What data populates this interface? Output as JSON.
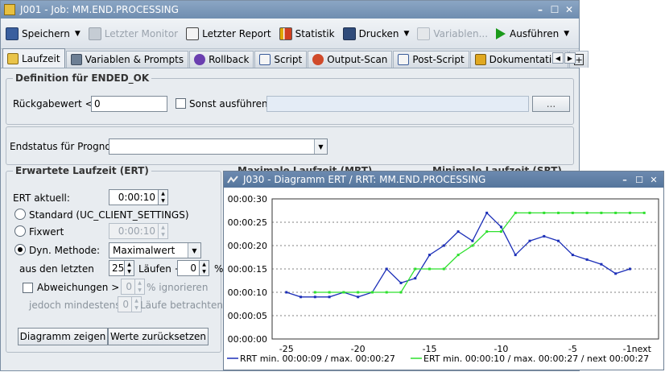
{
  "window": {
    "title": "J001 - Job: MM.END.PROCESSING",
    "controls": {
      "minimize": "–",
      "maximize": "☐",
      "close": "✕"
    }
  },
  "toolbar": {
    "save": "Speichern",
    "last_monitor": "Letzter Monitor",
    "last_report": "Letzter Report",
    "statistics": "Statistik",
    "print": "Drucken",
    "variables": "Variablen...",
    "execute": "Ausführen"
  },
  "tabs": [
    {
      "label": "Laufzeit",
      "active": true
    },
    {
      "label": "Variablen & Prompts"
    },
    {
      "label": "Rollback"
    },
    {
      "label": "Script"
    },
    {
      "label": "Output-Scan"
    },
    {
      "label": "Post-Script"
    },
    {
      "label": "Dokumentation"
    }
  ],
  "definition": {
    "legend": "Definition für ENDED_OK",
    "return_label": "Rückgabewert <=:",
    "return_value": "0",
    "else_label": "Sonst ausführen:",
    "browse_label": "..."
  },
  "endstatus": {
    "label": "Endstatus für Prognose:",
    "value": ""
  },
  "ert": {
    "legend": "Erwartete Laufzeit (ERT)",
    "current_label": "ERT aktuell:",
    "current_value": "0:00:10",
    "standard_label": "Standard (UC_CLIENT_SETTINGS)",
    "fixed_label": "Fixwert",
    "fixed_value": "0:00:10",
    "dyn_label": "Dyn. Methode:",
    "dyn_value": "Maximalwert",
    "last_label": "aus den letzten",
    "last_value": "25",
    "runs_plus": "Läufen +",
    "plus_value": "0",
    "percent": "%",
    "deviation_label": "Abweichungen >",
    "deviation_value": "0",
    "ignore_label": "% ignorieren",
    "min_label": "jedoch mindestens:",
    "min_value": "0",
    "runs_consider": "Läufe betrachten",
    "show_chart": "Diagramm zeigen",
    "reset_values": "Werte zurücksetzen",
    "behind_mrt": "Maximale Laufzeit (MRT)",
    "behind_srt": "Minimale Laufzeit (SRT)"
  },
  "diagram": {
    "title": "J030 - Diagramm ERT / RRT: MM.END.PROCESSING",
    "legend_rrt": "RRT min. 00:00:09 / max. 00:00:27",
    "legend_ert": "ERT min. 00:00:10 / max. 00:00:27 / next 00:00:27"
  },
  "chart_data": {
    "type": "line",
    "x": [
      -25,
      -24,
      -23,
      -22,
      -21,
      -20,
      -19,
      -18,
      -17,
      -16,
      -15,
      -14,
      -13,
      -12,
      -11,
      -10,
      -9,
      -8,
      -7,
      -6,
      -5,
      -4,
      -3,
      -2,
      -1,
      0
    ],
    "x_ticks": [
      "-25",
      "-20",
      "-15",
      "-10",
      "-5",
      "-1next"
    ],
    "x_tick_positions": [
      -25,
      -20,
      -15,
      -10,
      -5,
      -0.5
    ],
    "y_ticks": [
      "00:00:00",
      "00:00:05",
      "00:00:10",
      "00:00:15",
      "00:00:20",
      "00:00:25",
      "00:00:30"
    ],
    "ylim": [
      0,
      30
    ],
    "grid": true,
    "legend_position": "bottom",
    "series": [
      {
        "name": "RRT",
        "color": "#1c2fb8",
        "values": [
          10,
          9,
          9,
          9,
          10,
          9,
          10,
          15,
          12,
          13,
          18,
          20,
          23,
          21,
          27,
          24,
          18,
          21,
          22,
          21,
          18,
          17,
          16,
          14,
          15,
          null
        ]
      },
      {
        "name": "ERT",
        "color": "#2ee02e",
        "values": [
          null,
          null,
          10,
          10,
          10,
          10,
          10,
          10,
          10,
          15,
          15,
          15,
          18,
          20,
          23,
          23,
          27,
          27,
          27,
          27,
          27,
          27,
          27,
          27,
          27,
          27
        ]
      }
    ]
  }
}
